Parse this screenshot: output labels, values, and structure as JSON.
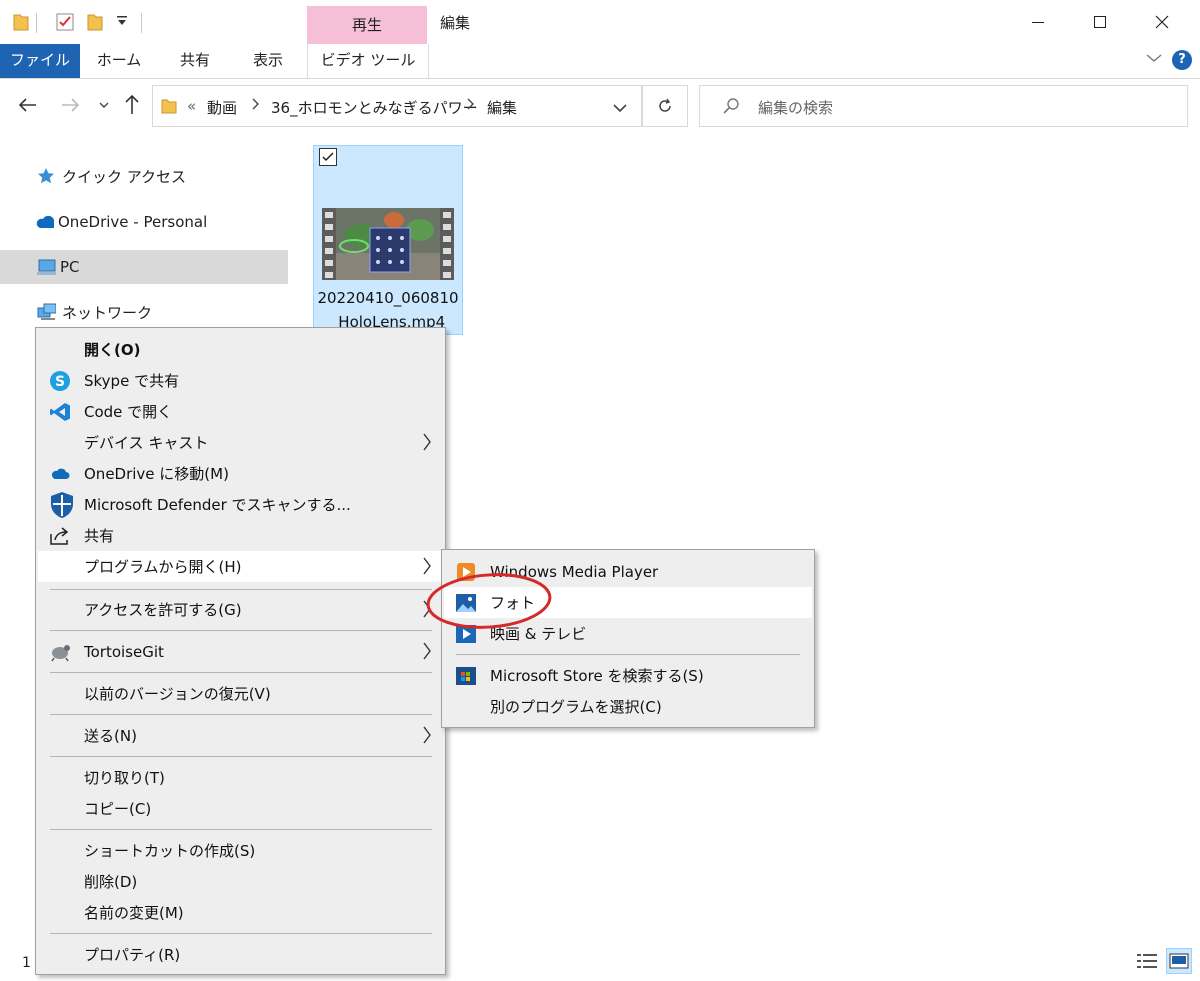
{
  "titlebar": {
    "contextual_tab_header": "再生",
    "window_title": "編集",
    "minimize_icon": "minimize-icon",
    "maximize_icon": "maximize-icon",
    "close_icon": "close-icon"
  },
  "ribbon": {
    "tabs": [
      "ファイル",
      "ホーム",
      "共有",
      "表示",
      "ビデオ ツール"
    ],
    "help_label": "?"
  },
  "address": {
    "overflow": "«",
    "crumbs": [
      "動画",
      "36_ホロモンとみなぎるパワー",
      "編集"
    ]
  },
  "search": {
    "placeholder": "編集の検索"
  },
  "navpane": {
    "items": [
      "クイック アクセス",
      "OneDrive - Personal",
      "PC",
      "ネットワーク"
    ]
  },
  "file": {
    "name": "20220410_060810_HoloLens.mp4",
    "checked": true
  },
  "context_menu": {
    "items": [
      "開く(O)",
      "Skype で共有",
      "Code で開く",
      "デバイス キャスト",
      "OneDrive に移動(M)",
      "Microsoft Defender でスキャンする...",
      "共有",
      "プログラムから開く(H)",
      "アクセスを許可する(G)",
      "TortoiseGit",
      "以前のバージョンの復元(V)",
      "送る(N)",
      "切り取り(T)",
      "コピー(C)",
      "ショートカットの作成(S)",
      "削除(D)",
      "名前の変更(M)",
      "プロパティ(R)"
    ]
  },
  "submenu": {
    "items": [
      "Windows Media Player",
      "フォト",
      "映画 & テレビ",
      "Microsoft Store を検索する(S)",
      "別のプログラムを選択(C)"
    ],
    "highlighted": "フォト",
    "annotation_color": "#d42a2a"
  },
  "statusbar": {
    "count": "1"
  },
  "colors": {
    "file_tab": "#1f64b3",
    "contextual_tab": "#f6bfd8",
    "selection": "#cce8ff"
  }
}
